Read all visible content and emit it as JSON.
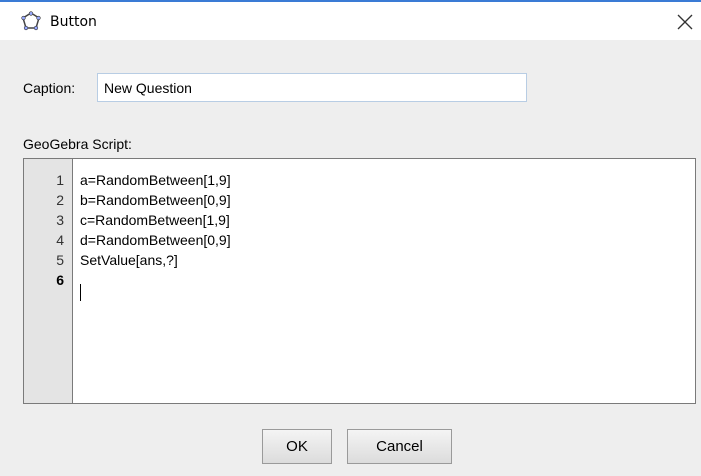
{
  "window": {
    "title": "Button",
    "icon": "geogebra-object-icon",
    "close_icon": "close-icon"
  },
  "caption": {
    "label": "Caption:",
    "value": "New Question"
  },
  "script": {
    "label": "GeoGebra Script:",
    "current_line": 6,
    "lines": [
      {
        "num": "1",
        "text": "a=RandomBetween[1,9]"
      },
      {
        "num": "2",
        "text": "b=RandomBetween[0,9]"
      },
      {
        "num": "3",
        "text": "c=RandomBetween[1,9]"
      },
      {
        "num": "4",
        "text": "d=RandomBetween[0,9]"
      },
      {
        "num": "5",
        "text": "SetValue[ans,?]"
      },
      {
        "num": "6",
        "text": ""
      }
    ]
  },
  "buttons": {
    "ok_label": "OK",
    "cancel_label": "Cancel"
  },
  "colors": {
    "dialog_background": "#eeeeee",
    "gutter_background": "#e4e4e4",
    "input_border": "#b8cde4",
    "accent_line": "#3a7bd5"
  }
}
